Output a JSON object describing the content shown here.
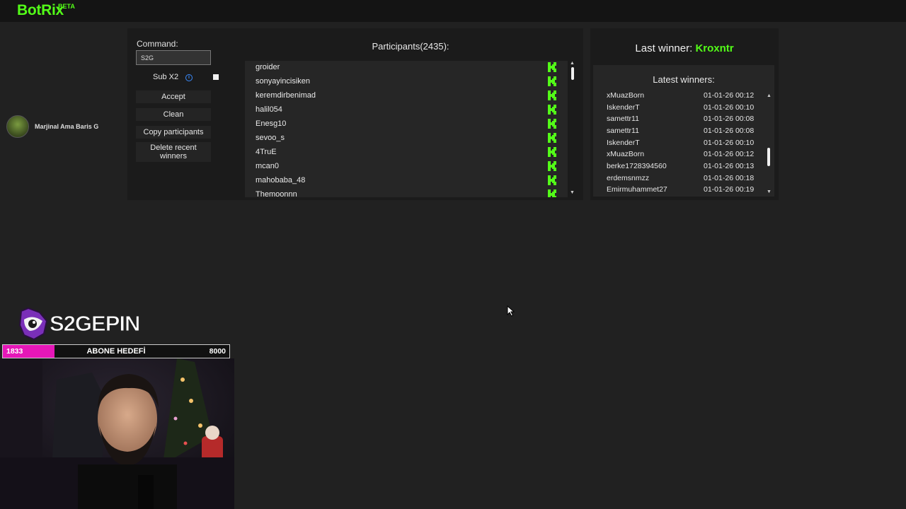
{
  "app": {
    "name": "BotRix",
    "badge": "BETA"
  },
  "user": {
    "name": "Marjinal Ama Baris G"
  },
  "giveaway": {
    "command_label": "Command:",
    "command_value": "S2G",
    "sub_label": "Sub X2",
    "sub_checked": true,
    "buttons": {
      "accept": "Accept",
      "clean": "Clean",
      "copy": "Copy participants",
      "delete": "Delete recent winners"
    },
    "participants_title": "Participants(2435):",
    "participants": [
      "groider",
      "sonyayincisiken",
      "keremdirbenimad",
      "halil054",
      "Enesg10",
      "sevoo_s",
      "4TruE",
      "mcan0",
      "mahobaba_48",
      "Themoonnn"
    ]
  },
  "winners": {
    "last_winner_label": "Last winner:",
    "last_winner": "Kroxntr",
    "latest_title": "Latest winners:",
    "items": [
      {
        "name": "xMuazBorn",
        "date": "01-01-26 00:12"
      },
      {
        "name": "IskenderT",
        "date": "01-01-26 00:10"
      },
      {
        "name": "samettr11",
        "date": "01-01-26 00:08"
      },
      {
        "name": "samettr11",
        "date": "01-01-26 00:08"
      },
      {
        "name": "IskenderT",
        "date": "01-01-26 00:10"
      },
      {
        "name": "xMuazBorn",
        "date": "01-01-26 00:12"
      },
      {
        "name": "berke1728394560",
        "date": "01-01-26 00:13"
      },
      {
        "name": "erdemsnmzz",
        "date": "01-01-26 00:18"
      },
      {
        "name": "Emirmuhammet27",
        "date": "01-01-26 00:19"
      }
    ]
  },
  "overlay": {
    "brand": "S2GEPIN",
    "goal_title": "ABONE HEDEFİ",
    "goal_current": "1833",
    "goal_target": "8000",
    "goal_progress": 0.229
  },
  "colors": {
    "accent": "#53fc18",
    "goal_fill": "#e617b8"
  },
  "icons": {
    "platform": "kick-icon",
    "info": "info-icon",
    "cursor": "mouse-pointer-icon"
  }
}
